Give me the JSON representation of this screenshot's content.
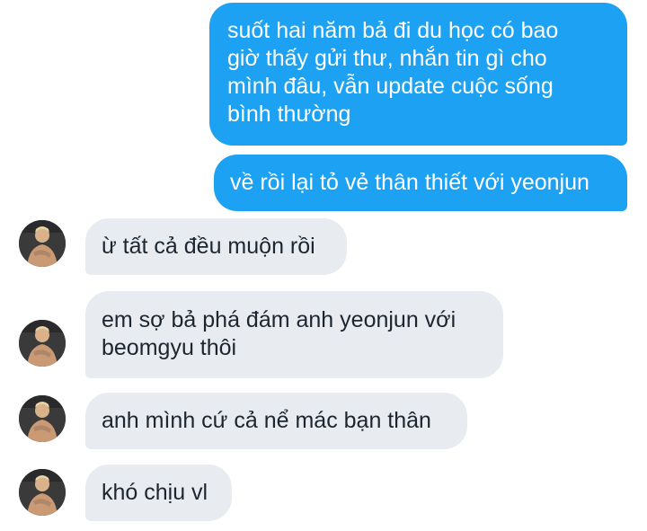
{
  "conversation": {
    "messages": [
      {
        "sender": "me",
        "text": "suốt hai năm bả đi du học có bao\ngiờ thấy gửi thư, nhắn tin gì cho\nmình đâu, vẫn update cuộc sống\nbình thường"
      },
      {
        "sender": "me",
        "text": "về rồi lại tỏ vẻ thân thiết với yeonjun"
      },
      {
        "sender": "other",
        "text": "ừ tất cả đều muộn rồi"
      },
      {
        "sender": "other",
        "text": "em sợ bả phá đám anh yeonjun với\nbeomgyu thôi"
      },
      {
        "sender": "other",
        "text": "anh mình cứ cả nể mác bạn thân"
      },
      {
        "sender": "other",
        "text": "khó chịu vl"
      }
    ]
  },
  "colors": {
    "sent_bubble": "#1da1f2",
    "received_bubble": "#e8ecf0",
    "sent_text": "#ffffff",
    "received_text": "#1c2530"
  }
}
